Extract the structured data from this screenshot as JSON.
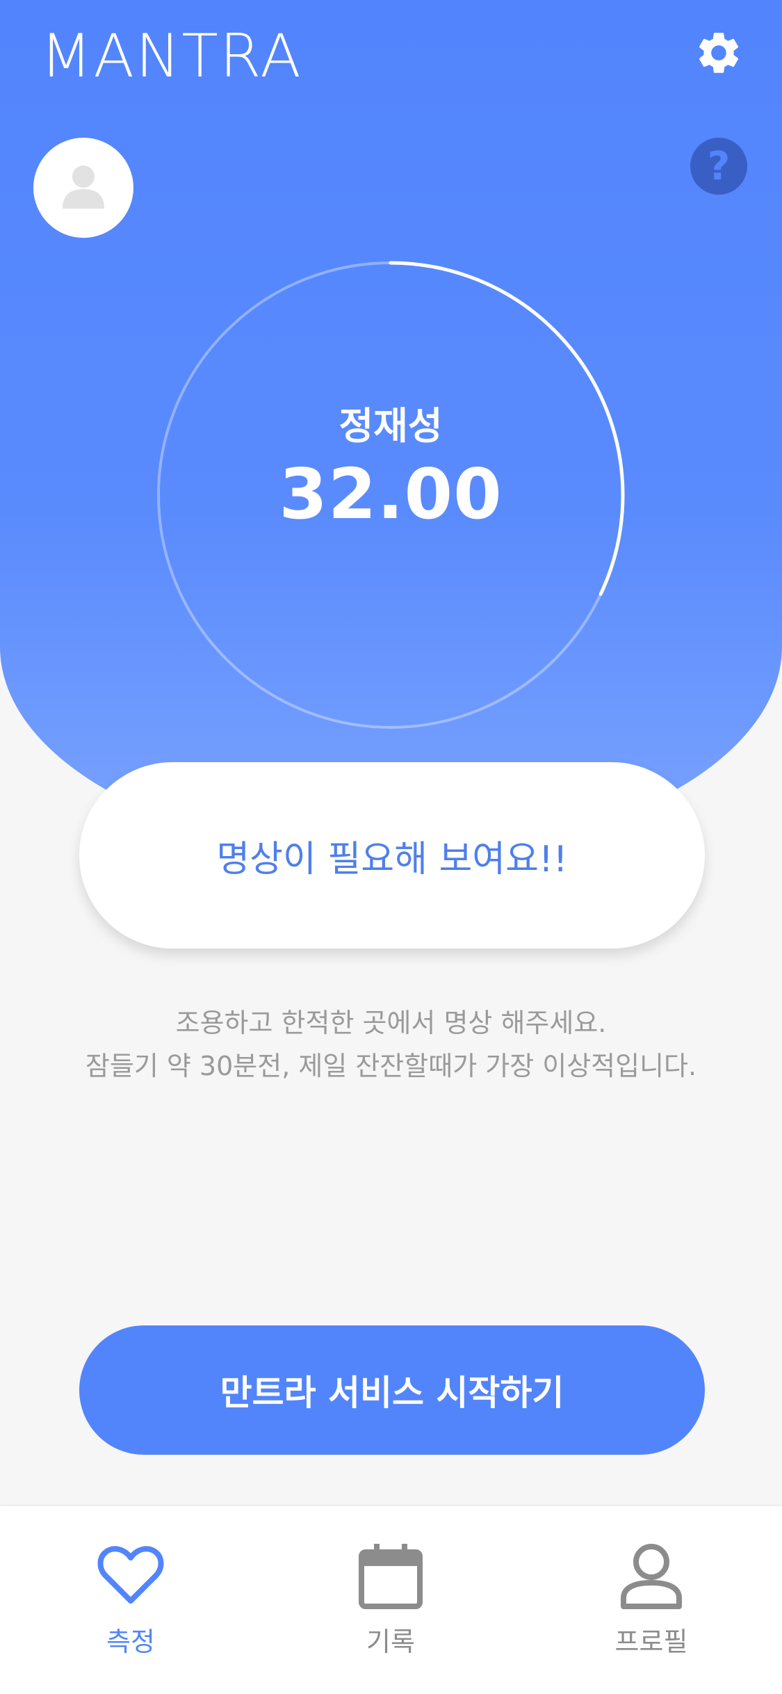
{
  "header": {
    "logo_text": "MANTRA",
    "settings_icon": "gear-icon",
    "help_icon": "question-circle-icon",
    "avatar_icon": "user-avatar-icon"
  },
  "gauge": {
    "label": "정재성",
    "value": "32.00",
    "progress": 0.32
  },
  "message": {
    "text": "명상이 필요해 보여요!!"
  },
  "tips": {
    "line1": "조용하고 한적한 곳에서 명상 해주세요.",
    "line2": "잠들기 약 30분전, 제일 잔잔할때가 가장 이상적입니다."
  },
  "start_button": {
    "label": "만트라 서비스 시작하기"
  },
  "tabs": [
    {
      "label": "측정",
      "icon": "heart-icon",
      "active": true
    },
    {
      "label": "기록",
      "icon": "calendar-icon",
      "active": false
    },
    {
      "label": "프로필",
      "icon": "person-icon",
      "active": false
    }
  ],
  "colors": {
    "primary": "#5285fc",
    "accent_text": "#4f7fec",
    "inactive": "#8c8c8c",
    "background": "#f6f6f6"
  }
}
